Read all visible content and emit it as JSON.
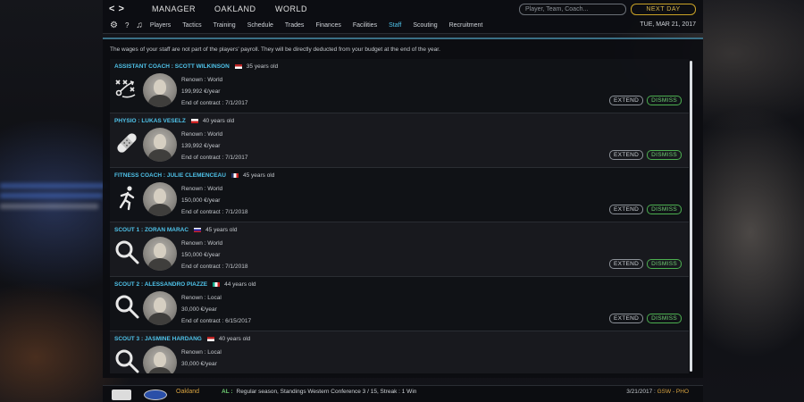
{
  "topbar": {
    "back_arrow": "<",
    "forward_arrow": ">",
    "modes": [
      "MANAGER",
      "OAKLAND",
      "WORLD"
    ],
    "search_placeholder": "Player, Team, Coach...",
    "next_day": "NEXT DAY",
    "date": "TUE, MAR 21, 2017",
    "tabs": [
      "Players",
      "Tactics",
      "Training",
      "Schedule",
      "Trades",
      "Finances",
      "Facilities",
      "Staff",
      "Scouting",
      "Recruitment"
    ],
    "active_tab": "Staff"
  },
  "panel": {
    "info": "The wages of your staff are not part of the players' payroll. They will be directly deducted from your budget at the end of the year.",
    "staff": [
      {
        "role": "ASSISTANT COACH : SCOTT WILKINSON",
        "flag": "us",
        "age": "35 years old",
        "renown": "Renown : World",
        "wage": "199,992 €/year",
        "contract": "End of contract : 7/1/2017",
        "icon": "tactics-icon",
        "extend": "EXTEND",
        "dismiss": "DISMISS"
      },
      {
        "role": "PHYSIO : LUKAS VESELZ",
        "flag": "cz",
        "age": "40 years old",
        "renown": "Renown : World",
        "wage": "139,992 €/year",
        "contract": "End of contract : 7/1/2017",
        "icon": "bandage-icon",
        "extend": "EXTEND",
        "dismiss": "DISMISS"
      },
      {
        "role": "FITNESS COACH : JULIE CLEMENCEAU",
        "flag": "fr",
        "age": "45 years old",
        "renown": "Renown : World",
        "wage": "150,000 €/year",
        "contract": "End of contract : 7/1/2018",
        "icon": "runner-icon",
        "extend": "EXTEND",
        "dismiss": "DISMISS"
      },
      {
        "role": "SCOUT 1 : ZORAN MARAC",
        "flag": "si",
        "age": "45 years old",
        "renown": "Renown : World",
        "wage": "150,000 €/year",
        "contract": "End of contract : 7/1/2018",
        "icon": "magnifier-icon",
        "extend": "EXTEND",
        "dismiss": "DISMISS"
      },
      {
        "role": "SCOUT 2 : ALESSANDRO PIAZZE",
        "flag": "it",
        "age": "44 years old",
        "renown": "Renown : Local",
        "wage": "30,000 €/year",
        "contract": "End of contract : 6/15/2017",
        "icon": "magnifier-icon",
        "extend": "EXTEND",
        "dismiss": "DISMISS"
      },
      {
        "role": "SCOUT 3 : JASMINE HARDANG",
        "flag": "us",
        "age": "40 years old",
        "renown": "Renown : Local",
        "wage": "30,000 €/year",
        "contract": "",
        "icon": "magnifier-icon",
        "extend": "",
        "dismiss": ""
      }
    ]
  },
  "bottom": {
    "team": "Oakland",
    "tag": "AL :",
    "news": "Regular season, Standings Western Conference 3 / 15, Streak : 1 Win",
    "score_date": "3/21/2017 :",
    "score_teams": "GSW - PHO"
  },
  "colors": {
    "accent": "#4fc3ea",
    "dismiss": "#4caf50",
    "next_day": "#c9a227",
    "team": "#d8a340"
  }
}
